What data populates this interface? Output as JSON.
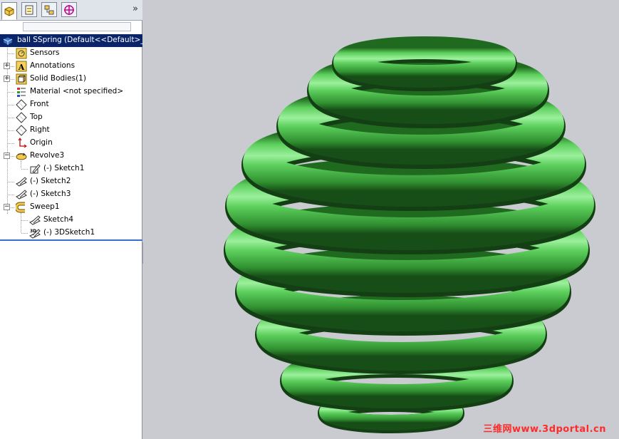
{
  "panel": {
    "tabs": [
      "feature-manager-tab",
      "property-manager-tab",
      "configuration-manager-tab",
      "dimxpert-manager-tab"
    ],
    "collapse_glyph": "»",
    "tree": {
      "root": "ball SSpring  (Default<<Default>_PH",
      "items": [
        {
          "label": "Sensors",
          "icon": "sensors-icon"
        },
        {
          "label": "Annotations",
          "icon": "annotations-icon",
          "expandable": true
        },
        {
          "label": "Solid Bodies(1)",
          "icon": "solid-bodies-icon",
          "expandable": true
        },
        {
          "label": "Material <not specified>",
          "icon": "material-icon"
        },
        {
          "label": "Front",
          "icon": "plane-icon"
        },
        {
          "label": "Top",
          "icon": "plane-icon"
        },
        {
          "label": "Right",
          "icon": "plane-icon"
        },
        {
          "label": "Origin",
          "icon": "origin-icon"
        },
        {
          "label": "Revolve3",
          "icon": "revolve-icon",
          "expanded": true
        },
        {
          "label": "(-) Sketch1",
          "icon": "sketch-icon",
          "child": true
        },
        {
          "label": "(-) Sketch2",
          "icon": "sketch-icon"
        },
        {
          "label": "(-) Sketch3",
          "icon": "sketch-icon"
        },
        {
          "label": "Sweep1",
          "icon": "sweep-icon",
          "expanded": true
        },
        {
          "label": "Sketch4",
          "icon": "sketch-icon",
          "child": true
        },
        {
          "label": "(-) 3DSketch1",
          "icon": "3dsketch-icon",
          "child": true
        }
      ]
    }
  },
  "viewport": {
    "model": "green helical spring ball",
    "colors": {
      "spring": "#5ccf5c",
      "spring_dark": "#1f6a1f",
      "background": "#c9cbd0"
    }
  },
  "watermark": "三维网www.3dportal.cn"
}
